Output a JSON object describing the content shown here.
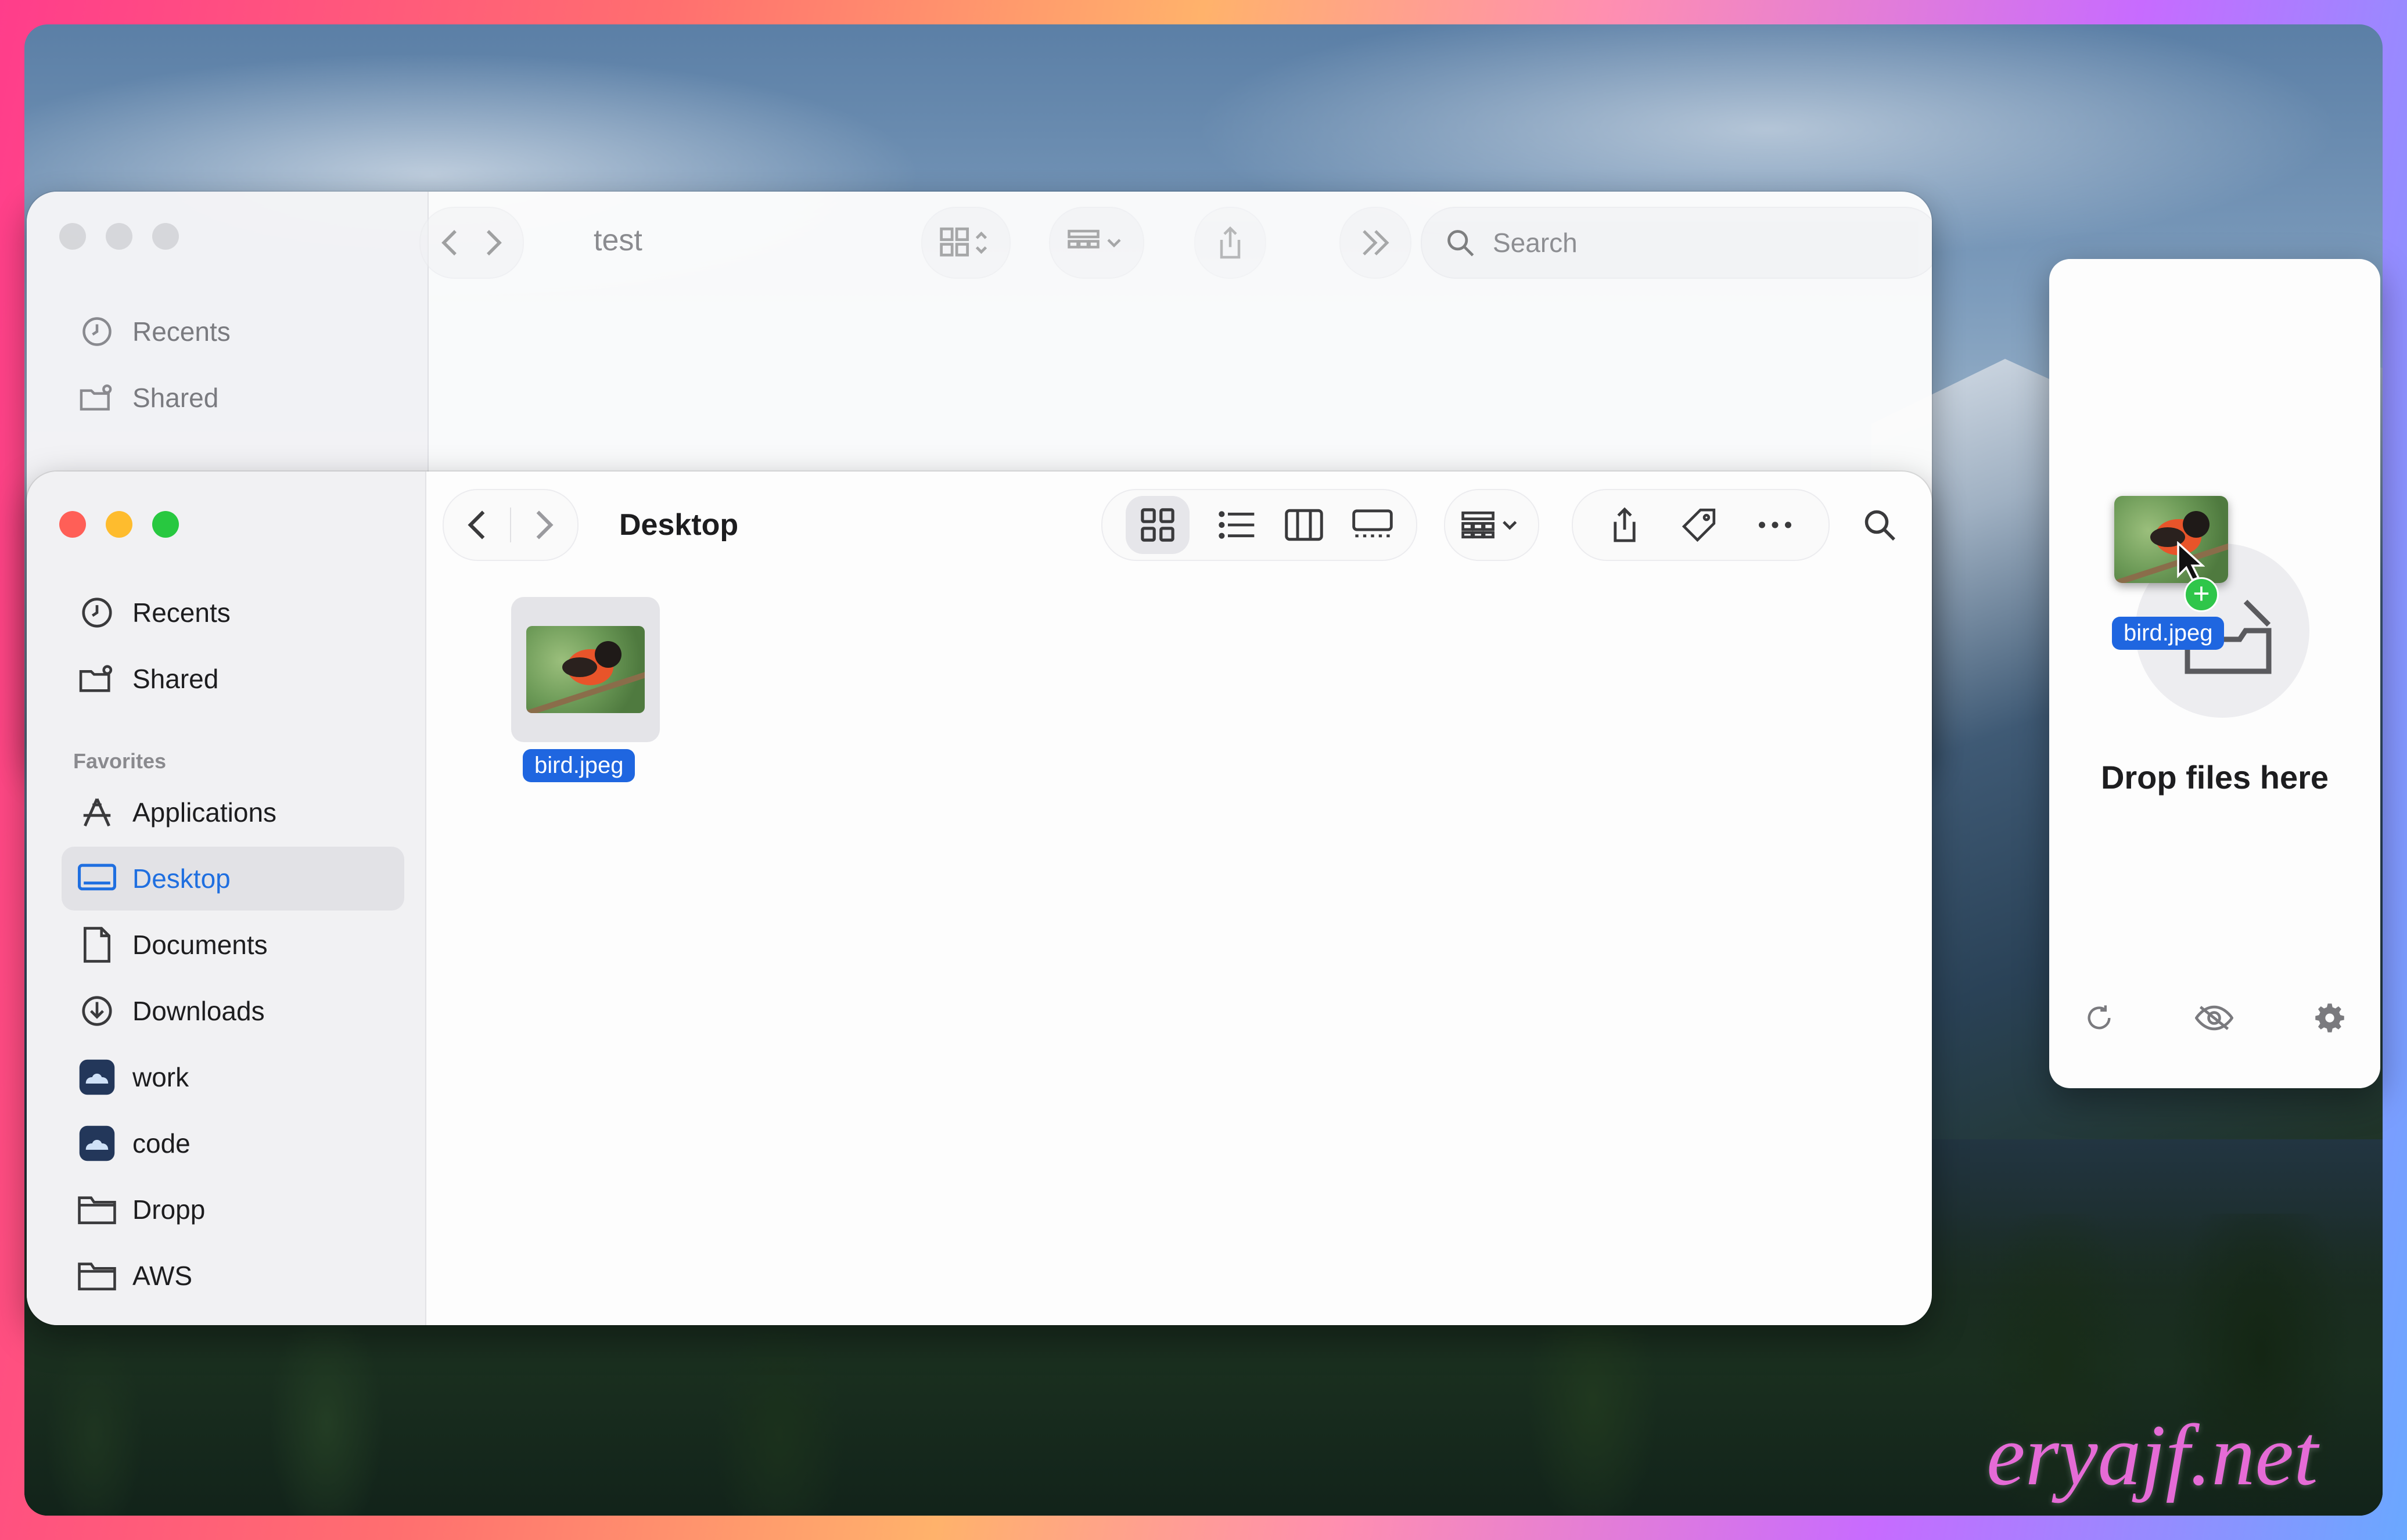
{
  "back_window": {
    "title": "test",
    "search_placeholder": "Search",
    "sidebar": [
      "Recents",
      "Shared"
    ]
  },
  "front_window": {
    "title": "Desktop",
    "sidebar": {
      "items_top": [
        "Recents",
        "Shared"
      ],
      "section_label": "Favorites",
      "favorites": [
        {
          "label": "Applications",
          "icon": "applications-icon"
        },
        {
          "label": "Desktop",
          "icon": "desktop-icon",
          "selected": true
        },
        {
          "label": "Documents",
          "icon": "document-icon"
        },
        {
          "label": "Downloads",
          "icon": "download-icon"
        },
        {
          "label": "work",
          "icon": "cloud-drive-icon"
        },
        {
          "label": "code",
          "icon": "cloud-drive-icon"
        },
        {
          "label": "Dropp",
          "icon": "folder-icon"
        },
        {
          "label": "AWS",
          "icon": "folder-icon"
        }
      ]
    },
    "files": [
      {
        "name": "bird.jpeg"
      }
    ]
  },
  "drop_panel": {
    "drag_file_label": "bird.jpeg",
    "message": "Drop files here"
  },
  "watermark": "eryajf.net",
  "colors": {
    "accent": "#1f66e0",
    "close": "#ff5f57",
    "minimize": "#febc2e",
    "zoom": "#28c840",
    "inactive_light": "#d6d6da"
  }
}
